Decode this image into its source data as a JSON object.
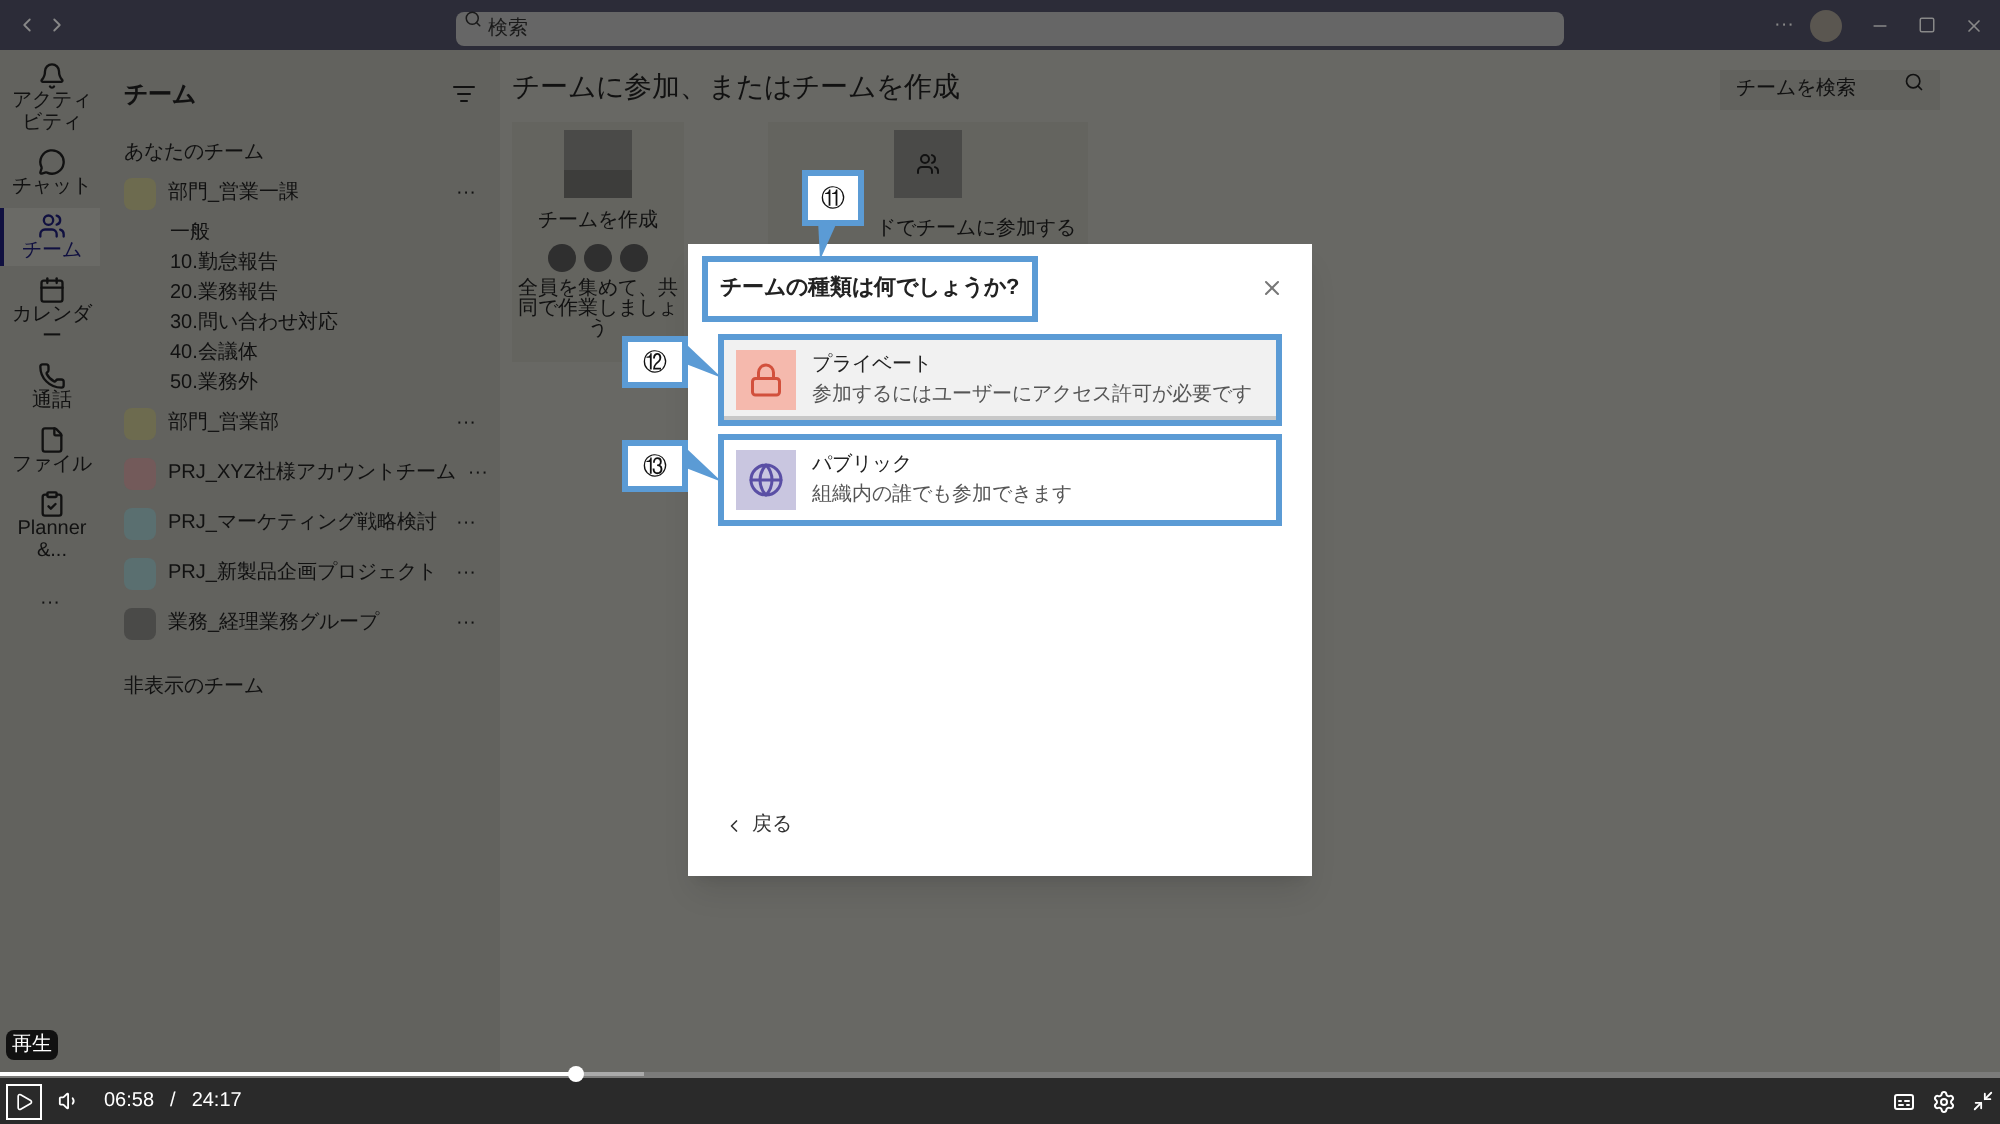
{
  "top_bar": {
    "search": {
      "placeholder": "検索"
    },
    "more": "···"
  },
  "rail": [
    {
      "kind": "bell",
      "label": "アクティビティ",
      "selected": false
    },
    {
      "kind": "chat",
      "label": "チャット",
      "selected": false
    },
    {
      "kind": "teams",
      "label": "チーム",
      "selected": true
    },
    {
      "kind": "calendar",
      "label": "カレンダー",
      "selected": false
    },
    {
      "kind": "phone",
      "label": "通話",
      "selected": false
    },
    {
      "kind": "file",
      "label": "ファイル",
      "selected": false
    },
    {
      "kind": "planner",
      "label": "Planner &...",
      "selected": false
    },
    {
      "kind": "more",
      "label": "···",
      "selected": false
    }
  ],
  "sidebar": {
    "title": "チーム",
    "section": "あなたのチーム",
    "teams": [
      {
        "name": "部門_営業一課",
        "color": "#6d6b4f",
        "children": [
          {
            "label": "一般"
          },
          {
            "label": "10.勤怠報告"
          },
          {
            "label": "20.業務報告"
          },
          {
            "label": "30.問い合わせ対応"
          },
          {
            "label": "40.会議体"
          },
          {
            "label": "50.業務外"
          }
        ]
      },
      {
        "name": "部門_営業部",
        "color": "#6d6b4f"
      },
      {
        "name": "PRJ_XYZ社様アカウントチーム",
        "color": "#735a5a"
      },
      {
        "name": "PRJ_マーケティング戦略検討",
        "color": "#5a6f70"
      },
      {
        "name": "PRJ_新製品企画プロジェクト",
        "color": "#5a6f70"
      },
      {
        "name": "業務_経理業務グループ",
        "color": "#4a4a48"
      }
    ],
    "hidden_section": "非表示のチーム",
    "more": "···"
  },
  "main": {
    "title": "チームに参加、またはチームを作成",
    "search": {
      "placeholder": "チームを検索"
    },
    "cards": [
      {
        "kind": "create",
        "title": "チームを作成",
        "description": "全員を集めて、共同で作業しましょう"
      },
      {
        "kind": "code",
        "title": "ドでチームに参加する"
      }
    ]
  },
  "dialog": {
    "title": "チームの種類は何でしょうか?",
    "options": [
      {
        "kind": "private",
        "title": "プライベート",
        "description": "参加するにはユーザーにアクセス許可が必要です",
        "selected": true
      },
      {
        "kind": "public",
        "title": "パブリック",
        "description": "組織内の誰でも参加できます",
        "selected": false
      }
    ],
    "back": "戻る"
  },
  "callouts": [
    {
      "label": "⑪"
    },
    {
      "label": "⑫"
    },
    {
      "label": "⑬"
    }
  ],
  "player": {
    "tooltip": "再生",
    "time": "06:58",
    "separator": "/",
    "duration": "24:17",
    "level": 0.288
  }
}
